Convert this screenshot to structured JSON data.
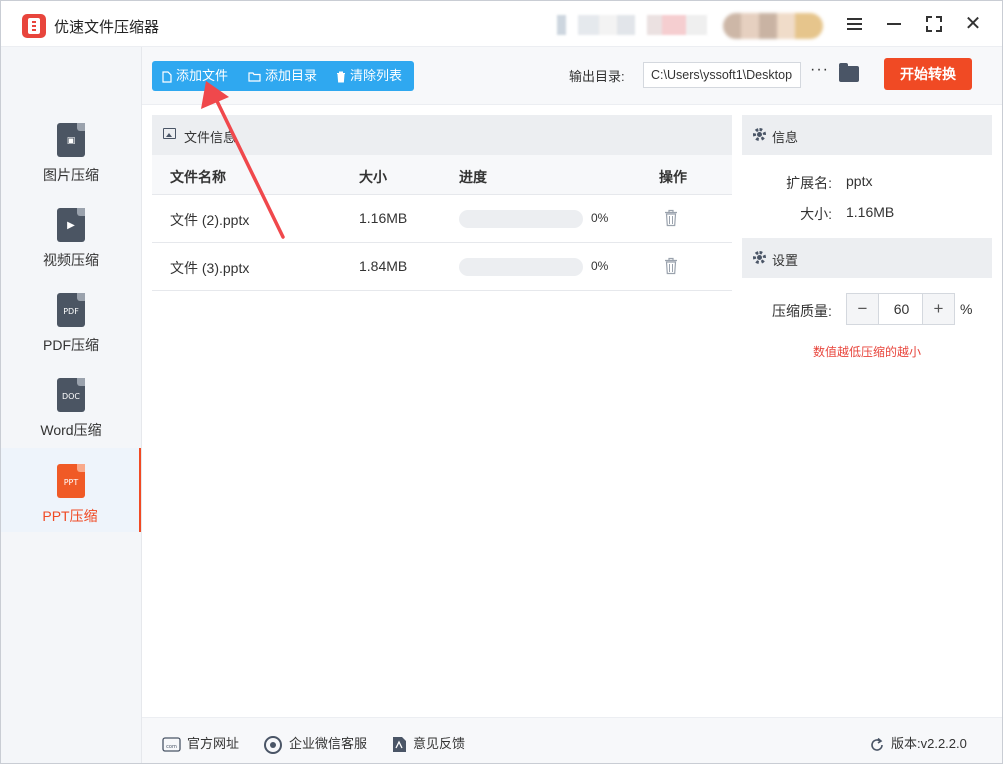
{
  "app": {
    "title": "优速文件压缩器"
  },
  "sidebar": {
    "items": [
      {
        "label": "图片压缩",
        "icon": "image-file-icon",
        "active": false
      },
      {
        "label": "视频压缩",
        "icon": "video-file-icon",
        "active": false
      },
      {
        "label": "PDF压缩",
        "icon": "pdf-file-icon",
        "glyph": "PDF",
        "active": false
      },
      {
        "label": "Word压缩",
        "icon": "doc-file-icon",
        "glyph": "DOC",
        "active": false
      },
      {
        "label": "PPT压缩",
        "icon": "ppt-file-icon",
        "glyph": "PPT",
        "active": true
      }
    ]
  },
  "toolbar": {
    "add_file": "添加文件",
    "add_dir": "添加目录",
    "clear_list": "清除列表",
    "output_label": "输出目录:",
    "output_path": "C:\\Users\\yssoft1\\Desktop",
    "more": "···",
    "start": "开始转换"
  },
  "file_panel": {
    "title": "文件信息",
    "columns": [
      "文件名称",
      "大小",
      "进度",
      "操作"
    ],
    "rows": [
      {
        "name": "文件 (2).pptx",
        "size": "1.16MB",
        "progress": 0,
        "progress_text": "0%"
      },
      {
        "name": "文件 (3).pptx",
        "size": "1.84MB",
        "progress": 0,
        "progress_text": "0%"
      }
    ]
  },
  "info_panel": {
    "title": "信息",
    "ext_key": "扩展名:",
    "ext_val": "pptx",
    "size_key": "大小:",
    "size_val": "1.16MB"
  },
  "settings_panel": {
    "title": "设置",
    "quality_label": "压缩质量:",
    "quality_value": "60",
    "minus": "−",
    "plus": "+",
    "percent": "%",
    "hint": "数值越低压缩的越小"
  },
  "footer": {
    "website": "官方网址",
    "wechat": "企业微信客服",
    "feedback": "意见反馈",
    "version": "版本:v2.2.2.0"
  },
  "colors": {
    "accent_blue": "#2fa8f0",
    "accent_orange": "#f04a24",
    "hint_red": "#e8453c"
  }
}
